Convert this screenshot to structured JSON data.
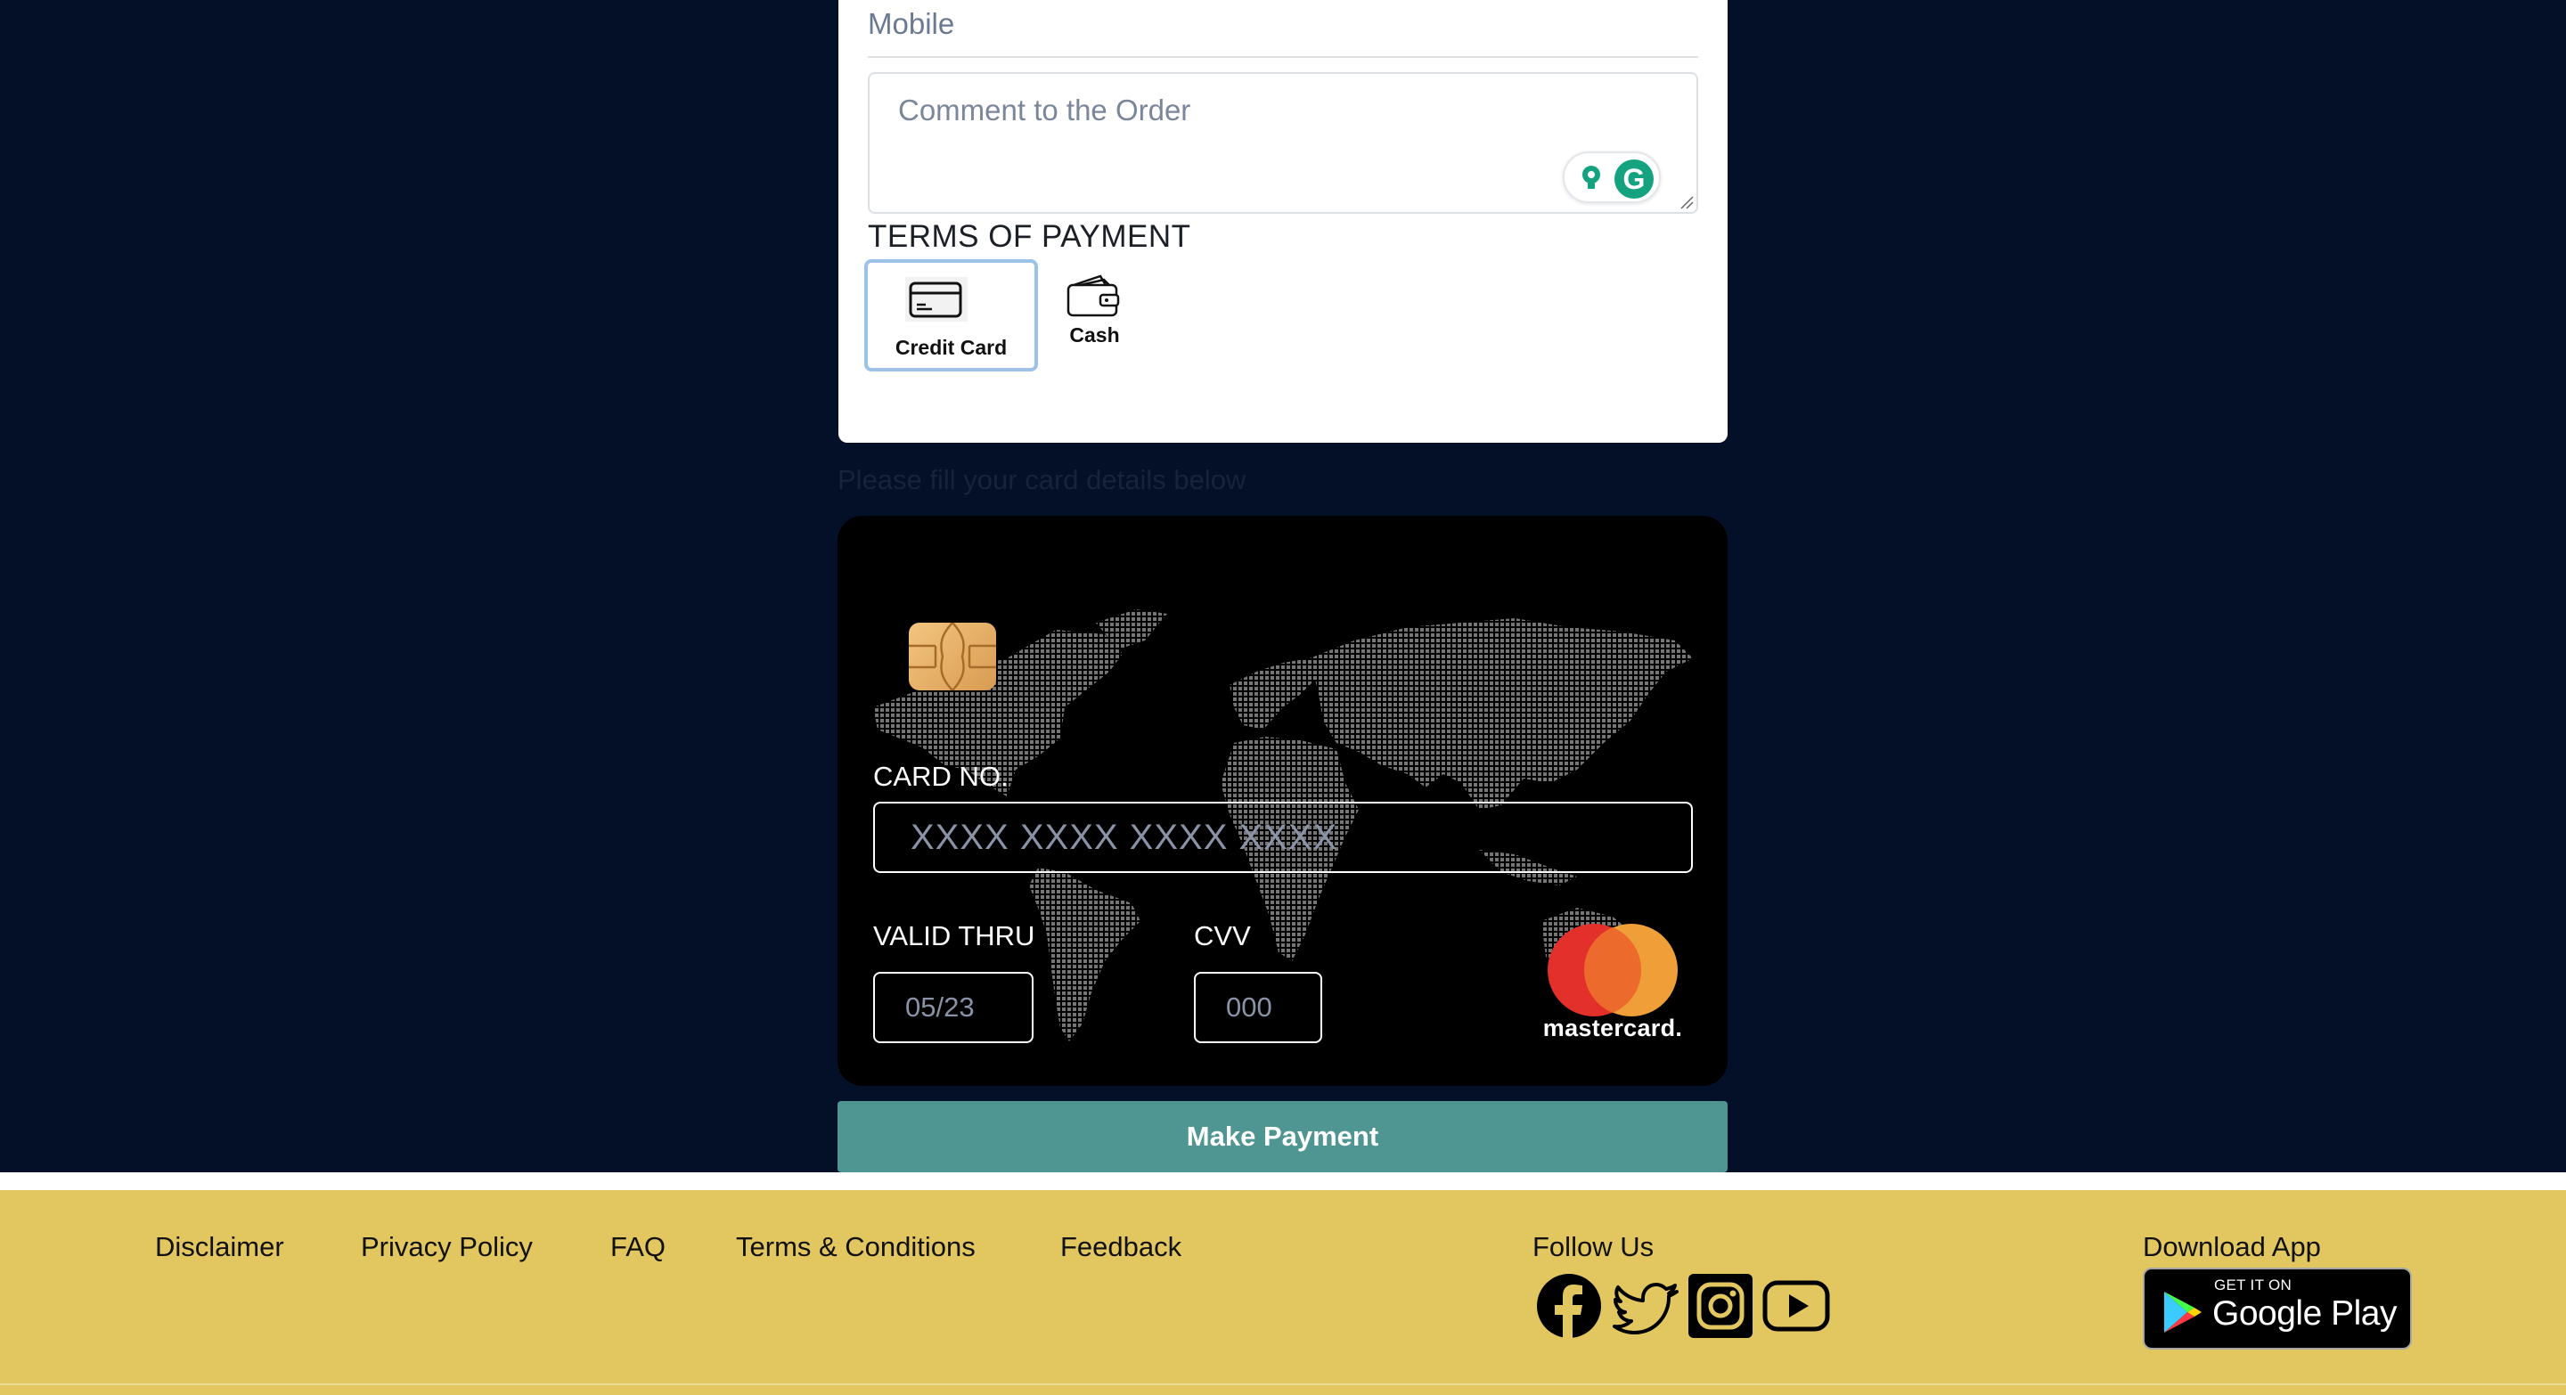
{
  "form": {
    "mobile_placeholder": "Mobile",
    "comment_placeholder": "Comment to the Order",
    "terms_title": "TERMS OF PAYMENT",
    "payment_options": [
      {
        "label": "Credit Card",
        "icon": "credit-card-icon",
        "selected": true
      },
      {
        "label": "Cash",
        "icon": "wallet-icon",
        "selected": false
      }
    ],
    "selected_color": "#9dc2e8"
  },
  "card_note": "Please fill your card details below",
  "card": {
    "card_no_label": "CARD NO.",
    "card_no_placeholder": "XXXX XXXX XXXX XXXX",
    "valid_thru_label": "VALID THRU",
    "valid_thru_placeholder": "05/23",
    "cvv_label": "CVV",
    "cvv_placeholder": "000",
    "brand": "mastercard",
    "brand_text": "mastercard."
  },
  "make_payment_label": "Make Payment",
  "colors": {
    "background": "#031028",
    "button": "#4f9592",
    "footer": "#e2c65f",
    "mc_red": "#e4302a",
    "mc_orange": "#f09e38"
  },
  "footer": {
    "links": [
      "Disclaimer",
      "Privacy Policy",
      "FAQ",
      "Terms & Conditions",
      "Feedback"
    ],
    "follow_title": "Follow Us",
    "social": [
      "facebook-icon",
      "twitter-icon",
      "instagram-icon",
      "youtube-icon"
    ],
    "download_title": "Download App",
    "store_small": "GET IT ON",
    "store_big": "Google Play"
  }
}
